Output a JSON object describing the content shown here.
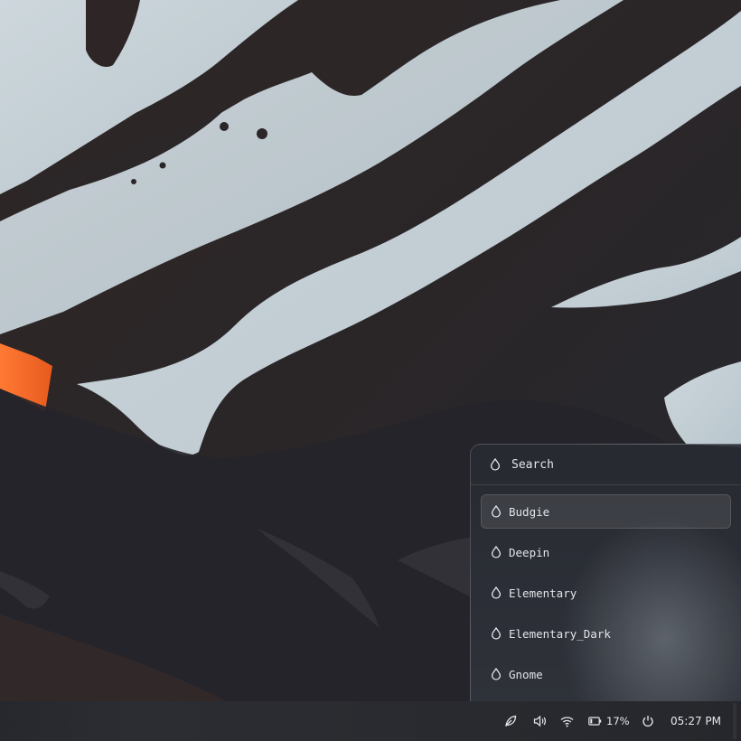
{
  "wallpaper": {
    "description": "mountain-snow-photo"
  },
  "launcher": {
    "search_placeholder": "Search",
    "items": [
      {
        "label": "Budgie",
        "icon": "drop-icon",
        "active": true
      },
      {
        "label": "Deepin",
        "icon": "drop-icon",
        "active": false
      },
      {
        "label": "Elementary",
        "icon": "drop-icon",
        "active": false
      },
      {
        "label": "Elementary_Dark",
        "icon": "drop-icon",
        "active": false
      },
      {
        "label": "Gnome",
        "icon": "drop-icon",
        "active": false
      }
    ]
  },
  "taskbar": {
    "tray_icons": [
      "leaf-icon",
      "volume-icon",
      "wifi-icon",
      "battery-icon",
      "power-icon"
    ],
    "battery_percent": "17%",
    "clock": "05:27 PM"
  },
  "colors": {
    "accent_orange": "#f26a2a",
    "snow": "#c9d3d9",
    "rock": "#2b2a2e",
    "panel": "#2a2c31",
    "text": "#e4e6ea"
  }
}
